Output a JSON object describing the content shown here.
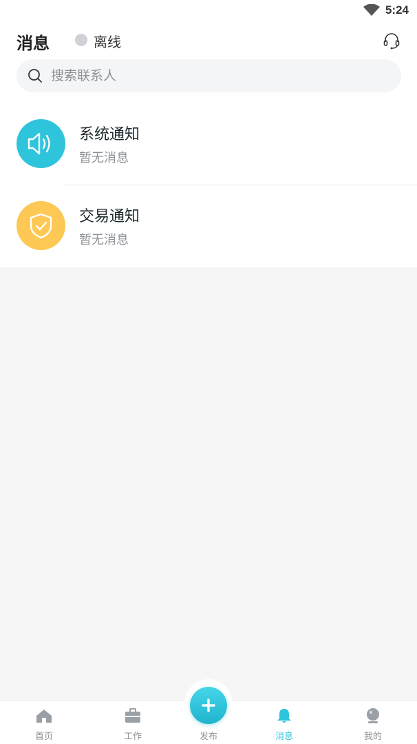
{
  "status_bar": {
    "time": "5:24",
    "wifi_icon": "wifi-icon"
  },
  "header": {
    "title": "消息",
    "connection_status": "离线",
    "status_dot_color": "#cfd2d6",
    "support_icon": "headset-icon"
  },
  "search": {
    "placeholder": "搜索联系人",
    "value": ""
  },
  "messages": [
    {
      "title": "系统通知",
      "subtitle": "暂无消息",
      "icon": "speaker-icon",
      "color": "#2ec5dc"
    },
    {
      "title": "交易通知",
      "subtitle": "暂无消息",
      "icon": "shield-check-icon",
      "color": "#fdc853"
    }
  ],
  "bottom_nav": {
    "items": [
      {
        "label": "首页",
        "icon": "home-icon"
      },
      {
        "label": "工作",
        "icon": "briefcase-icon"
      },
      {
        "label": "发布",
        "icon": "plus-icon"
      },
      {
        "label": "消息",
        "icon": "bell-icon",
        "active": true
      },
      {
        "label": "我的",
        "icon": "user-icon"
      }
    ],
    "active_color": "#2ec5dc"
  }
}
